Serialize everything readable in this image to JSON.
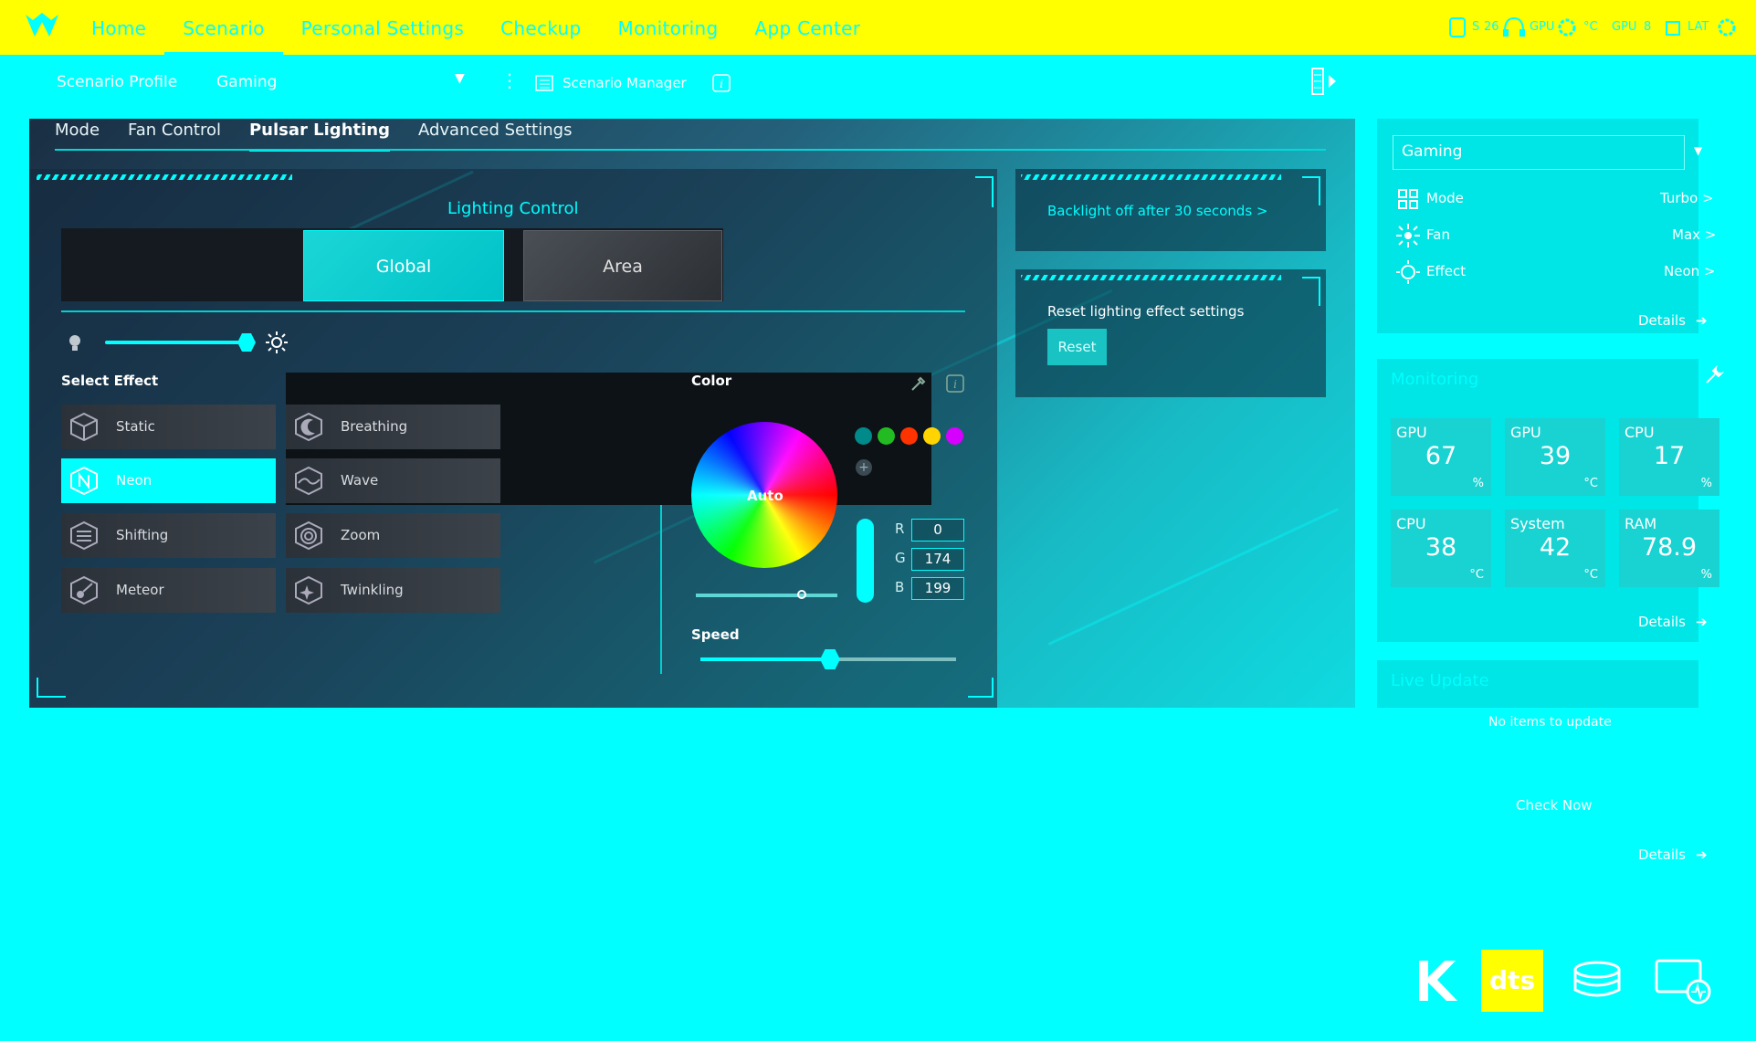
{
  "nav": {
    "items": [
      "Home",
      "Scenario",
      "Personal Settings",
      "Checkup",
      "Monitoring",
      "App Center"
    ],
    "active_index": 1
  },
  "status": {
    "cpu_label": "S",
    "cpu_value": "26",
    "gpu_label": "GPU",
    "gpu_value": "°C",
    "gpu_load_label": "GPU",
    "gpu_load_value": "8",
    "lat_label": "LAT"
  },
  "profile": {
    "label": "Scenario Profile",
    "value": "Gaming",
    "manager_label": "Scenario Manager"
  },
  "tabs": [
    "Mode",
    "Fan Control",
    "Pulsar Lighting",
    "Advanced Settings"
  ],
  "active_tab": 2,
  "lighting": {
    "title": "Lighting Control",
    "global_label": "Global",
    "area_label": "Area",
    "brightness_level": 0.85,
    "select_effect_label": "Select Effect",
    "effects": [
      {
        "label": "Static",
        "icon": "cube-icon"
      },
      {
        "label": "Breathing",
        "icon": "crescent-icon"
      },
      {
        "label": "Neon",
        "icon": "neon-n-icon"
      },
      {
        "label": "Wave",
        "icon": "wave-icon"
      },
      {
        "label": "Shifting",
        "icon": "shifting-icon"
      },
      {
        "label": "Zoom",
        "icon": "zoom-icon"
      },
      {
        "label": "Meteor",
        "icon": "meteor-icon"
      },
      {
        "label": "Twinkling",
        "icon": "twinkling-icon"
      }
    ],
    "selected_effect": "Neon",
    "color_label": "Color",
    "wheel_label": "Auto",
    "swatches": [
      "#008a8a",
      "#22bb22",
      "#ff3300",
      "#ffd400",
      "#d600ff"
    ],
    "rgb": {
      "r_label": "R",
      "g_label": "G",
      "b_label": "B",
      "r": "0",
      "g": "174",
      "b": "199"
    },
    "speed_label": "Speed",
    "speed_level": 0.45
  },
  "cards": {
    "backlight_text": "Backlight off after 30 seconds >",
    "reset_title": "Reset lighting effect settings",
    "reset_button": "Reset"
  },
  "sidebar": {
    "profile_select": "Gaming",
    "rows": [
      {
        "label": "Mode",
        "value": "Turbo >",
        "icon": "mode-grid-icon"
      },
      {
        "label": "Fan",
        "value": "Max >",
        "icon": "fan-icon"
      },
      {
        "label": "Effect",
        "value": "Neon >",
        "icon": "effect-sun-icon"
      }
    ],
    "details_label": "Details",
    "monitoring_title": "Monitoring",
    "tiles": [
      {
        "title": "GPU",
        "value": "67",
        "unit": "%"
      },
      {
        "title": "GPU",
        "value": "39",
        "unit": "°C"
      },
      {
        "title": "CPU",
        "value": "17",
        "unit": "%"
      },
      {
        "title": "CPU",
        "value": "38",
        "unit": "°C"
      },
      {
        "title": "System",
        "value": "42",
        "unit": "°C"
      },
      {
        "title": "RAM",
        "value": "78.9",
        "unit": "%"
      }
    ],
    "live_update_title": "Live Update",
    "no_items": "No items to update",
    "check_now": "Check Now"
  },
  "bottom_apps": [
    {
      "icon": "killer-k-icon"
    },
    {
      "icon": "dts-icon",
      "label": "dts"
    },
    {
      "icon": "storage-icon"
    },
    {
      "icon": "monitor-icon"
    }
  ],
  "colors": {
    "accent": "#00FFFF",
    "topbar": "#FFFF00",
    "dts_bg": "#FFFF00"
  }
}
